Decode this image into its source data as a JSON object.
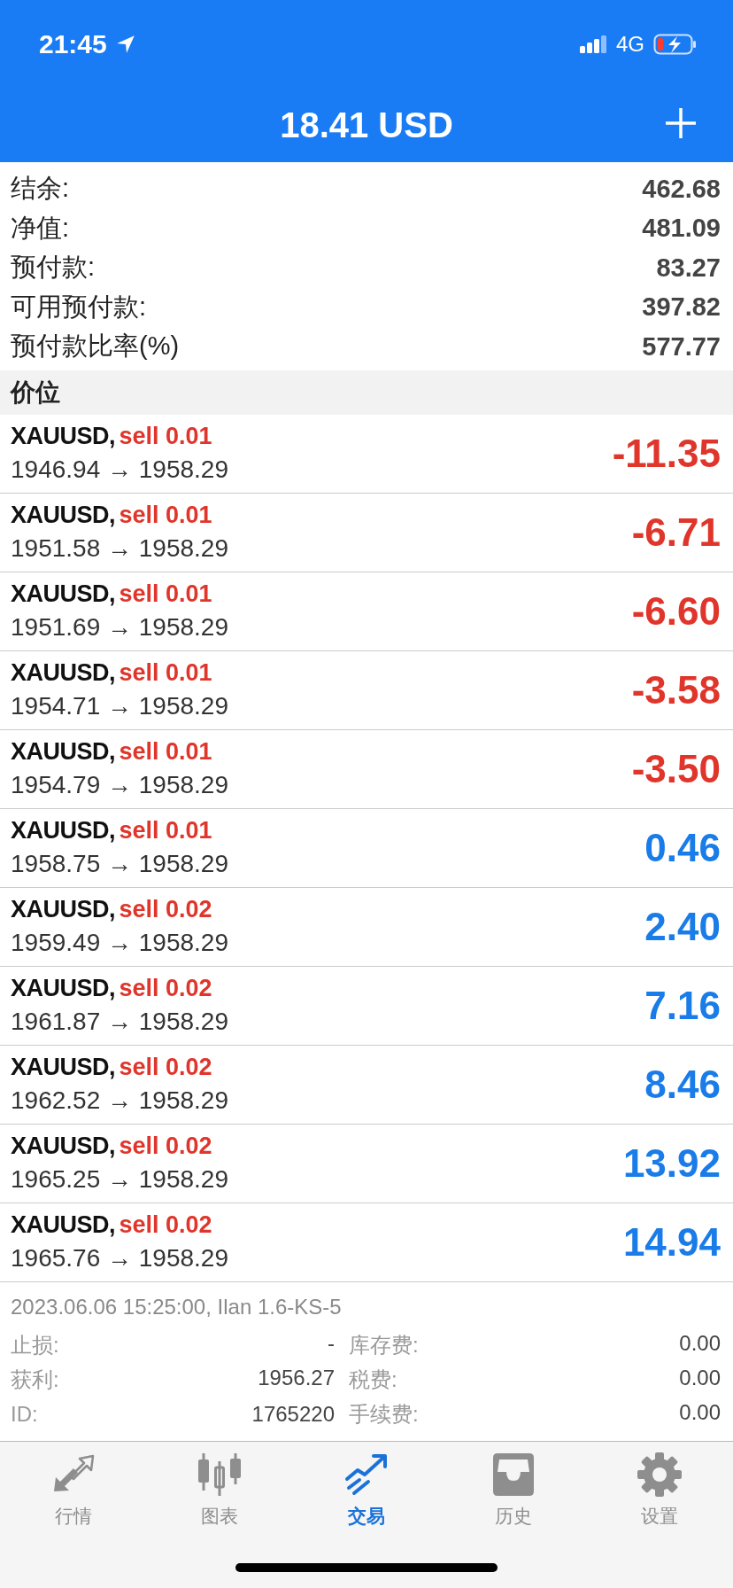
{
  "status_bar": {
    "time": "21:45",
    "network": "4G"
  },
  "header": {
    "title": "18.41 USD"
  },
  "summary": [
    {
      "label": "结余:",
      "value": "462.68"
    },
    {
      "label": "净值:",
      "value": "481.09"
    },
    {
      "label": "预付款:",
      "value": "83.27"
    },
    {
      "label": "可用预付款:",
      "value": "397.82"
    },
    {
      "label": "预付款比率(%)",
      "value": "577.77"
    }
  ],
  "section_title": "价位",
  "positions": [
    {
      "symbol": "XAUUSD,",
      "order": "sell 0.01",
      "prices": "1946.94 → 1958.29",
      "profit": "-11.35",
      "color": "#e0352b"
    },
    {
      "symbol": "XAUUSD,",
      "order": "sell 0.01",
      "prices": "1951.58 → 1958.29",
      "profit": "-6.71",
      "color": "#e0352b"
    },
    {
      "symbol": "XAUUSD,",
      "order": "sell 0.01",
      "prices": "1951.69 → 1958.29",
      "profit": "-6.60",
      "color": "#e0352b"
    },
    {
      "symbol": "XAUUSD,",
      "order": "sell 0.01",
      "prices": "1954.71 → 1958.29",
      "profit": "-3.58",
      "color": "#e0352b"
    },
    {
      "symbol": "XAUUSD,",
      "order": "sell 0.01",
      "prices": "1954.79 → 1958.29",
      "profit": "-3.50",
      "color": "#e0352b"
    },
    {
      "symbol": "XAUUSD,",
      "order": "sell 0.01",
      "prices": "1958.75 → 1958.29",
      "profit": "0.46",
      "color": "#1a7ce8"
    },
    {
      "symbol": "XAUUSD,",
      "order": "sell 0.02",
      "prices": "1959.49 → 1958.29",
      "profit": "2.40",
      "color": "#1a7ce8"
    },
    {
      "symbol": "XAUUSD,",
      "order": "sell 0.02",
      "prices": "1961.87 → 1958.29",
      "profit": "7.16",
      "color": "#1a7ce8"
    },
    {
      "symbol": "XAUUSD,",
      "order": "sell 0.02",
      "prices": "1962.52 → 1958.29",
      "profit": "8.46",
      "color": "#1a7ce8"
    },
    {
      "symbol": "XAUUSD,",
      "order": "sell 0.02",
      "prices": "1965.25 → 1958.29",
      "profit": "13.92",
      "color": "#1a7ce8"
    },
    {
      "symbol": "XAUUSD,",
      "order": "sell 0.02",
      "prices": "1965.76 → 1958.29",
      "profit": "14.94",
      "color": "#1a7ce8"
    }
  ],
  "details": {
    "timestamp": "2023.06.06 15:25:00, Ilan 1.6-KS-5",
    "rows": [
      {
        "label": "止损:",
        "value": "-",
        "label_2": "库存费:",
        "value_2": "0.00"
      },
      {
        "label": "获利:",
        "value": "1956.27",
        "label_2": "税费:",
        "value_2": "0.00"
      },
      {
        "label": "ID:",
        "value": "1765220",
        "label_2": "手续费:",
        "value_2": "0.00"
      }
    ]
  },
  "tabs": [
    {
      "label": "行情",
      "kind": "quotes",
      "selected": false
    },
    {
      "label": "图表",
      "kind": "chart",
      "selected": false
    },
    {
      "label": "交易",
      "kind": "trade",
      "selected": true
    },
    {
      "label": "历史",
      "kind": "history",
      "selected": false
    },
    {
      "label": "设置",
      "kind": "settings",
      "selected": false
    }
  ]
}
